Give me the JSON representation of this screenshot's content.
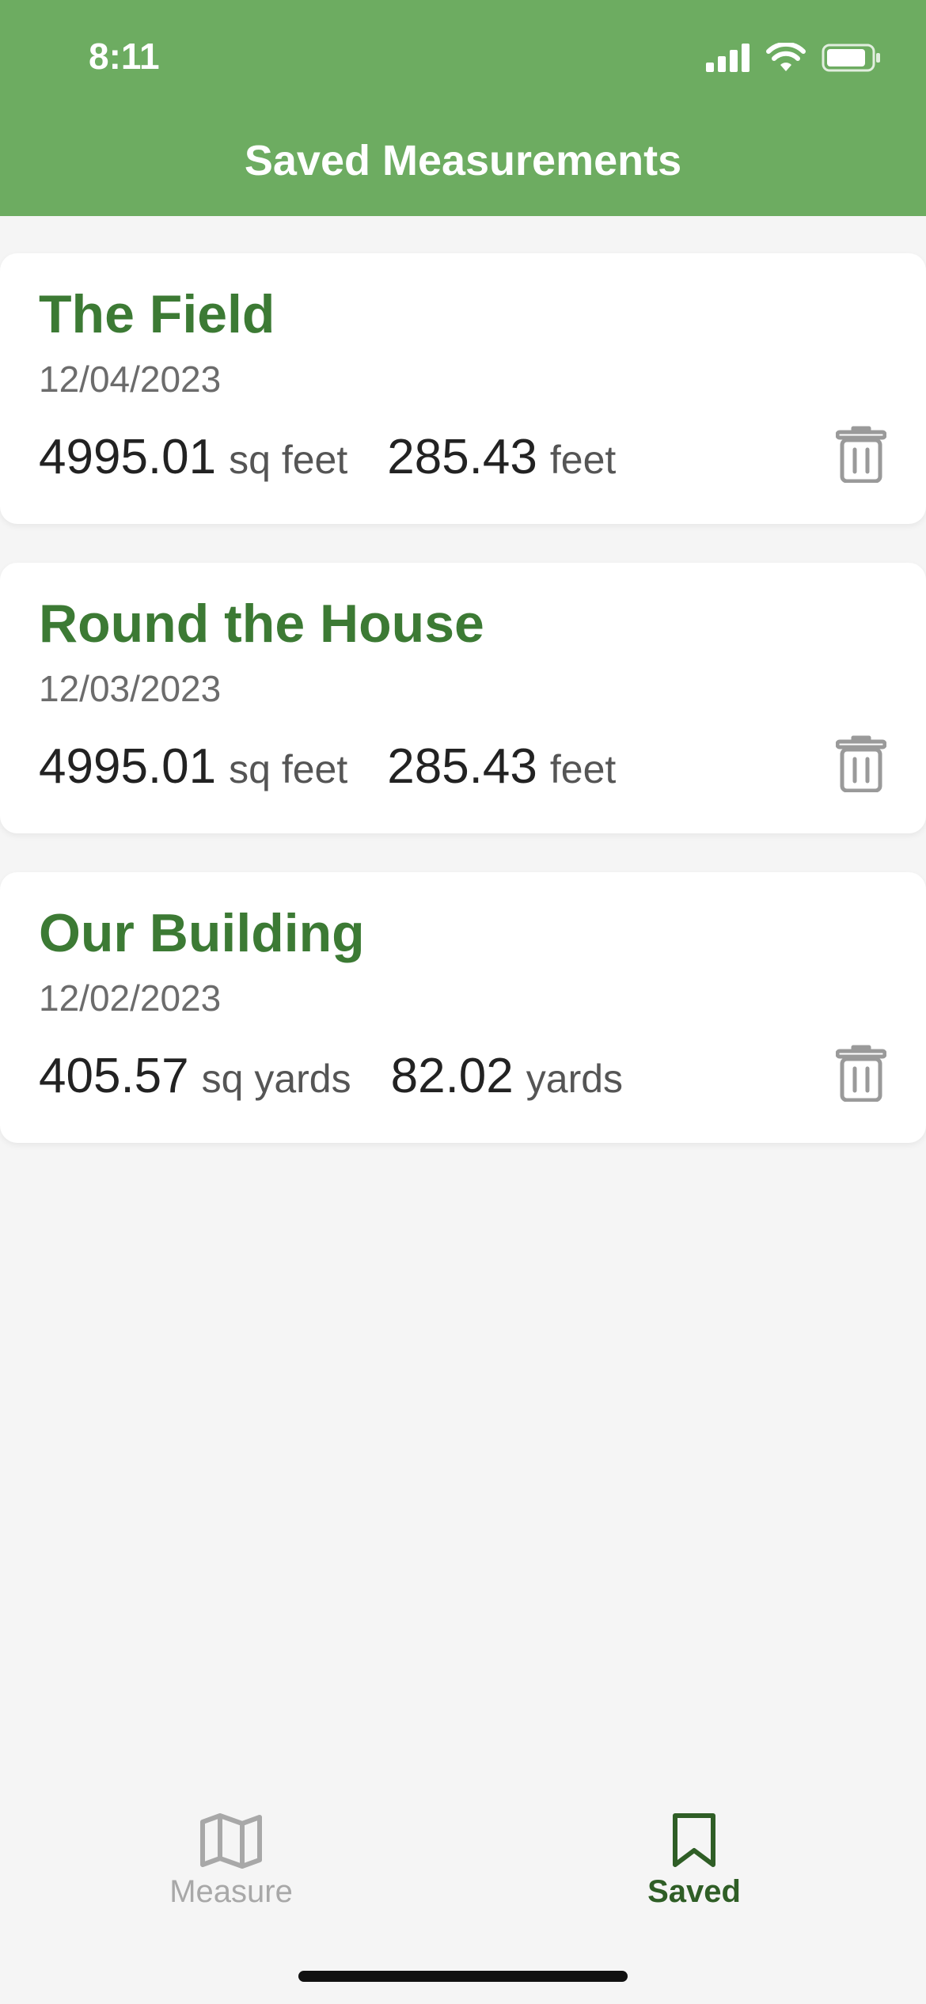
{
  "status_bar": {
    "time": "8:11"
  },
  "header": {
    "title": "Saved Measurements",
    "bg_color": "#6dac61"
  },
  "measurements": [
    {
      "name": "The Field",
      "date": "12/04/2023",
      "area_value": "4995.01",
      "area_unit": "sq feet",
      "perimeter_value": "285.43",
      "perimeter_unit": "feet"
    },
    {
      "name": "Round the House",
      "date": "12/03/2023",
      "area_value": "4995.01",
      "area_unit": "sq feet",
      "perimeter_value": "285.43",
      "perimeter_unit": "feet"
    },
    {
      "name": "Our Building",
      "date": "12/02/2023",
      "area_value": "405.57",
      "area_unit": "sq yards",
      "perimeter_value": "82.02",
      "perimeter_unit": "yards"
    }
  ],
  "tabs": [
    {
      "label": "Measure",
      "icon": "map-icon",
      "active": false
    },
    {
      "label": "Saved",
      "icon": "bookmark-icon",
      "active": true
    }
  ],
  "colors": {
    "accent_green": "#3c7a34",
    "active_tab": "#2f5e26",
    "inactive_tab": "#a8a8a8"
  }
}
